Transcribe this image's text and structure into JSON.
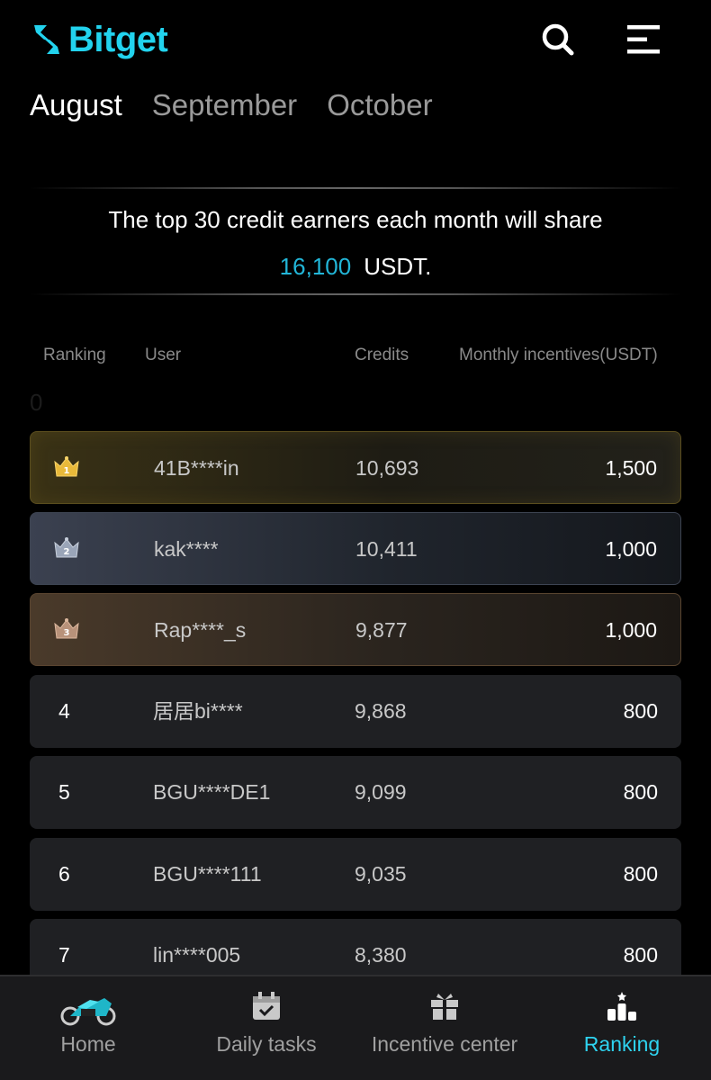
{
  "header": {
    "brand": "Bitget",
    "search_icon": "search-icon",
    "menu_icon": "menu-icon"
  },
  "months": [
    {
      "label": "August",
      "active": true
    },
    {
      "label": "September",
      "active": false
    },
    {
      "label": "October",
      "active": false
    }
  ],
  "banner": {
    "line1": "The top 30 credit earners each month will share",
    "amount": "16,100",
    "currency": "USDT."
  },
  "table": {
    "headers": {
      "ranking": "Ranking",
      "user": "User",
      "credits": "Credits",
      "incentives": "Monthly incentives(USDT)"
    },
    "stray_value": "0",
    "rows": [
      {
        "rank": "1",
        "user": "41B****in",
        "credits": "10,693",
        "incentive": "1,500",
        "medal": "gold-crown-icon"
      },
      {
        "rank": "2",
        "user": "kak****",
        "credits": "10,411",
        "incentive": "1,000",
        "medal": "silver-crown-icon"
      },
      {
        "rank": "3",
        "user": "Rap****_s",
        "credits": "9,877",
        "incentive": "1,000",
        "medal": "bronze-crown-icon"
      },
      {
        "rank": "4",
        "user": "居居bi****",
        "credits": "9,868",
        "incentive": "800"
      },
      {
        "rank": "5",
        "user": "BGU****DE1",
        "credits": "9,099",
        "incentive": "800"
      },
      {
        "rank": "6",
        "user": "BGU****111",
        "credits": "9,035",
        "incentive": "800"
      },
      {
        "rank": "7",
        "user": "lin****005",
        "credits": "8,380",
        "incentive": "800"
      }
    ]
  },
  "colors": {
    "accent": "#22d3ee",
    "amount": "#22b6d8",
    "background": "#000000",
    "row": "#1f2023"
  },
  "tabbar": {
    "home": {
      "label": "Home",
      "icon": "motorcycle-icon"
    },
    "daily": {
      "label": "Daily tasks",
      "icon": "calendar-check-icon"
    },
    "incentive": {
      "label": "Incentive center",
      "icon": "gift-icon"
    },
    "ranking": {
      "label": "Ranking",
      "icon": "podium-icon",
      "active": true
    }
  }
}
